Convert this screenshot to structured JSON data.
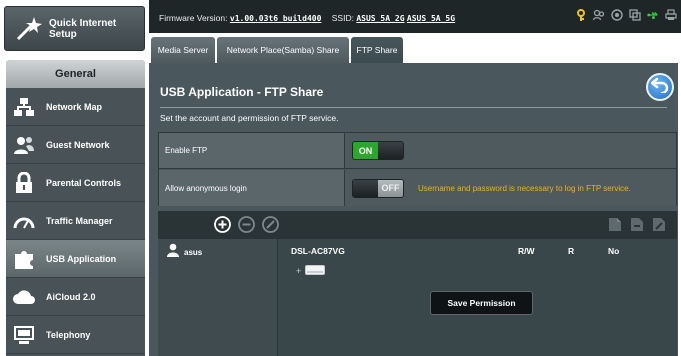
{
  "sidebar": {
    "quick_setup_label": "Quick Internet Setup",
    "section_header": "General",
    "items": [
      {
        "label": "Network Map",
        "icon": "network-map-icon"
      },
      {
        "label": "Guest Network",
        "icon": "guest-network-icon"
      },
      {
        "label": "Parental Controls",
        "icon": "lock-icon"
      },
      {
        "label": "Traffic Manager",
        "icon": "gauge-icon"
      },
      {
        "label": "USB Application",
        "icon": "puzzle-icon"
      },
      {
        "label": "AiCloud 2.0",
        "icon": "cloud-icon"
      },
      {
        "label": "Telephony",
        "icon": "telephony-icon"
      }
    ],
    "active_item": "USB Application"
  },
  "topbar": {
    "firmware_label": "Firmware Version:",
    "firmware_value": "v1.00.03t6_build400",
    "ssid_label": "SSID:",
    "ssid_1": "ASUS_5A_2G",
    "ssid_2": "ASUS_5A_5G"
  },
  "tabs": [
    {
      "label": "Media Server"
    },
    {
      "label": "Network Place(Samba) Share"
    },
    {
      "label": "FTP Share"
    }
  ],
  "active_tab": "FTP Share",
  "page": {
    "title": "USB Application - FTP Share",
    "description": "Set the account and permission of FTP service."
  },
  "settings": {
    "enable_ftp_label": "Enable FTP",
    "enable_ftp_state": "ON",
    "anonymous_label": "Allow anonymous login",
    "anonymous_state": "OFF",
    "anonymous_warning": "Username and password is necessary to log in FTP service."
  },
  "accounts": {
    "users": [
      {
        "name": "asus"
      }
    ],
    "device_name": "DSL-AC87VG",
    "perm_headers": [
      "R/W",
      "R",
      "No"
    ],
    "save_label": "Save Permission"
  },
  "colors": {
    "accent_green": "#2ea52f",
    "warning_yellow": "#f0b21a",
    "usb_green": "#3ad13a",
    "content_bg": "#4a575c"
  }
}
